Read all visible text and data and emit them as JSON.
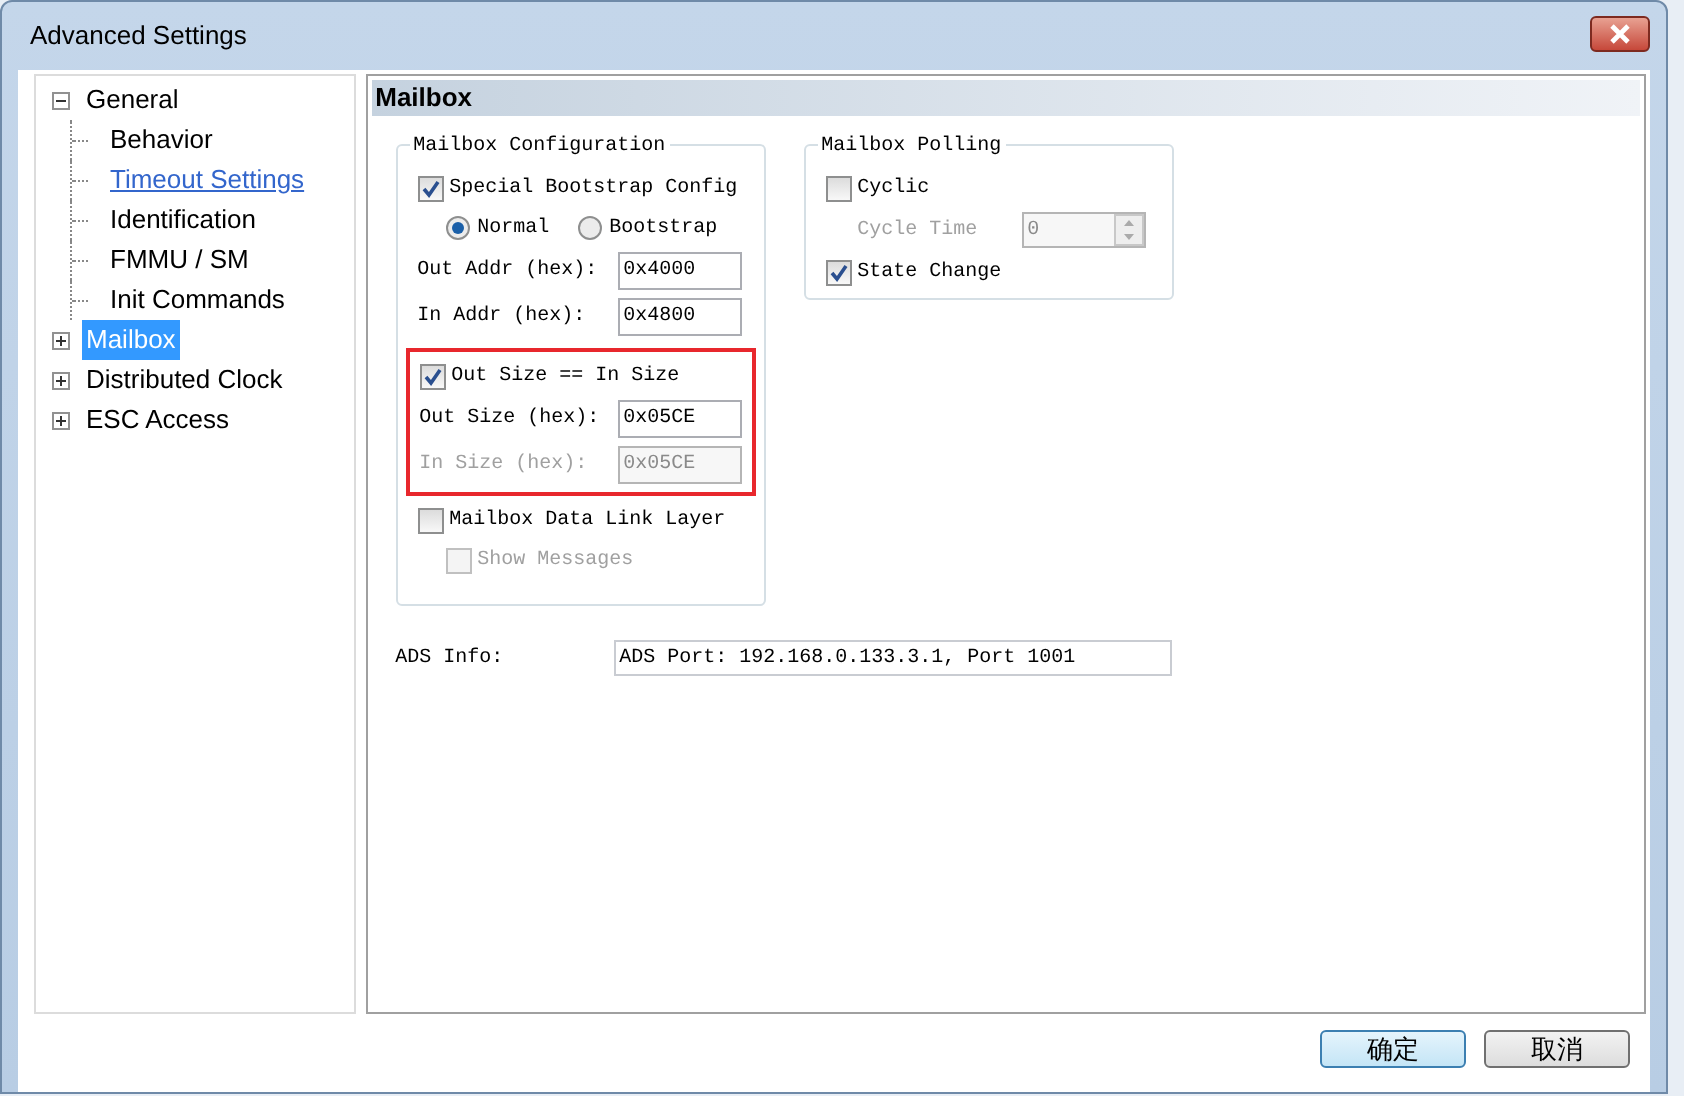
{
  "window": {
    "title": "Advanced Settings"
  },
  "tree": [
    {
      "label": "General",
      "expanded": true,
      "selected": false,
      "hovered": false,
      "children": [
        {
          "label": "Behavior",
          "selected": false,
          "hovered": false
        },
        {
          "label": "Timeout Settings",
          "selected": false,
          "hovered": true
        },
        {
          "label": "Identification",
          "selected": false,
          "hovered": false
        },
        {
          "label": "FMMU / SM",
          "selected": false,
          "hovered": false
        },
        {
          "label": "Init Commands",
          "selected": false,
          "hovered": false
        }
      ]
    },
    {
      "label": "Mailbox",
      "expanded": false,
      "selected": true,
      "hovered": false
    },
    {
      "label": "Distributed Clock",
      "expanded": false,
      "selected": false,
      "hovered": false
    },
    {
      "label": "ESC Access",
      "expanded": false,
      "selected": false,
      "hovered": false
    }
  ],
  "panel": {
    "title": "Mailbox",
    "configuration": {
      "title": "Mailbox Configuration",
      "special_bootstrap": {
        "label": "Special Bootstrap Config",
        "checked": true
      },
      "radios": [
        {
          "label": "Normal",
          "selected": true
        },
        {
          "label": "Bootstrap",
          "selected": false
        }
      ],
      "addr_fields": [
        {
          "label": "Out Addr (hex):",
          "value": "0x4000",
          "disabled": false
        },
        {
          "label": "In Addr (hex):",
          "value": "0x4800",
          "disabled": false
        }
      ],
      "size_group": {
        "highlighted": true,
        "checkbox": {
          "label": "Out Size == In Size",
          "checked": true
        },
        "fields": [
          {
            "label": "Out Size (hex):",
            "value": "0x05CE",
            "disabled": false
          },
          {
            "label": "In Size (hex):",
            "value": "0x05CE",
            "disabled": true
          }
        ]
      },
      "data_link": {
        "label": "Mailbox Data Link Layer",
        "checked": false,
        "disabled": false
      },
      "show_messages": {
        "label": "Show Messages",
        "checked": false,
        "disabled": true
      }
    },
    "polling": {
      "title": "Mailbox Polling",
      "cyclic": {
        "label": "Cyclic",
        "checked": false,
        "disabled": false
      },
      "cycle_time": {
        "label": "Cycle Time",
        "value": "0",
        "disabled": true
      },
      "state_change": {
        "label": "State Change",
        "checked": true,
        "disabled": false
      }
    },
    "ads": {
      "label": "ADS Info:",
      "value": "ADS Port: 192.168.0.133.3.1, Port 1001"
    }
  },
  "buttons": [
    {
      "label": "确定",
      "default": true
    },
    {
      "label": "取消",
      "default": false
    }
  ]
}
